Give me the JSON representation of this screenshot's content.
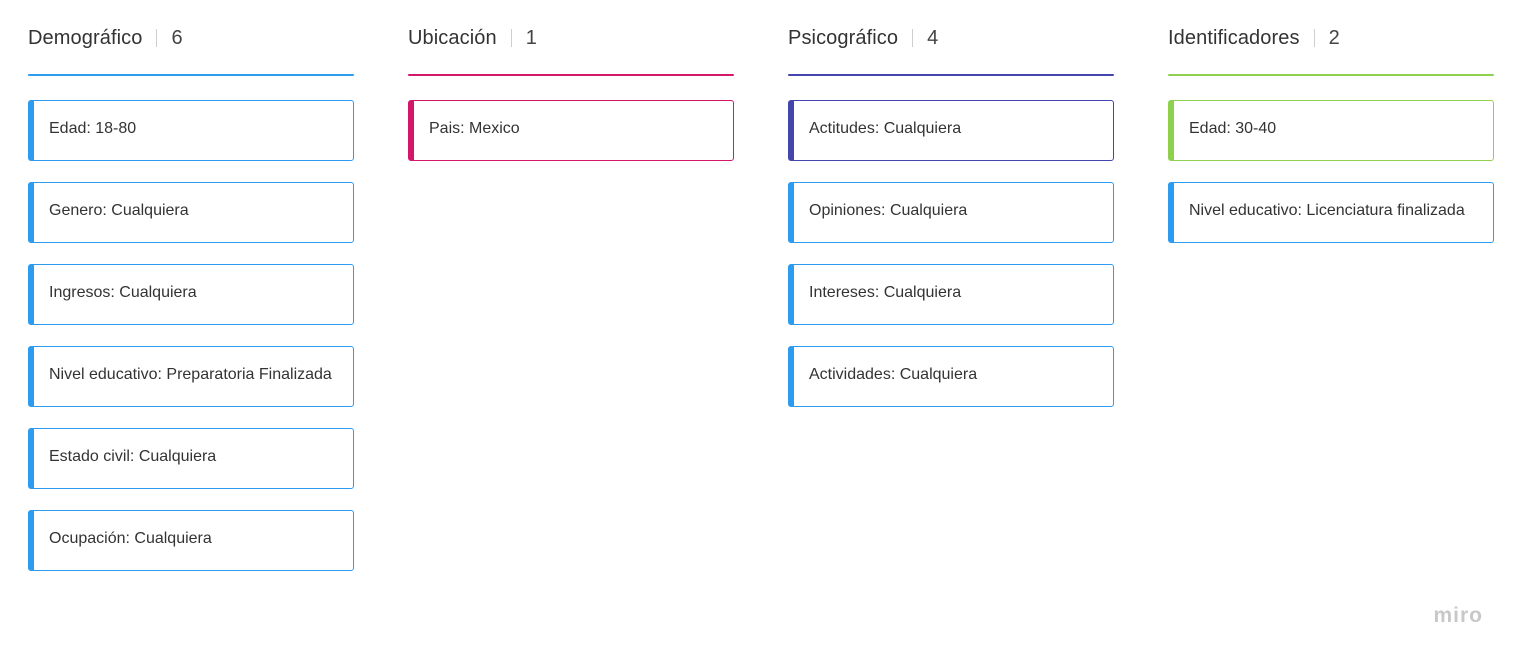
{
  "columns": [
    {
      "title": "Demográfico",
      "count": "6",
      "color": "#2d9bf0",
      "cards": [
        {
          "label": "Edad: 18-80"
        },
        {
          "label": "Genero: Cualquiera"
        },
        {
          "label": "Ingresos: Cualquiera"
        },
        {
          "label": "Nivel educativo: Preparatoria Finalizada"
        },
        {
          "label": "Estado civil: Cualquiera"
        },
        {
          "label": "Ocupación: Cualquiera"
        }
      ]
    },
    {
      "title": "Ubicación",
      "count": "1",
      "color": "#d5176c",
      "cards": [
        {
          "label": "Pais: Mexico"
        }
      ]
    },
    {
      "title": "Psicográfico",
      "count": "4",
      "color": "#4446ad",
      "cards": [
        {
          "label": "Actitudes: Cualquiera",
          "color": "#4446ad"
        },
        {
          "label": "Opiniones: Cualquiera",
          "color": "#2d9bf0"
        },
        {
          "label": "Intereses: Cualquiera",
          "color": "#2d9bf0"
        },
        {
          "label": "Actividades: Cualquiera",
          "color": "#2d9bf0"
        }
      ]
    },
    {
      "title": "Identificadores",
      "count": "2",
      "color": "#8fd14f",
      "cards": [
        {
          "label": "Edad: 30-40",
          "color": "#8fd14f"
        },
        {
          "label": "Nivel educativo: Licenciatura finalizada",
          "color": "#2d9bf0"
        }
      ]
    }
  ],
  "branding": {
    "logo_text": "miro"
  }
}
